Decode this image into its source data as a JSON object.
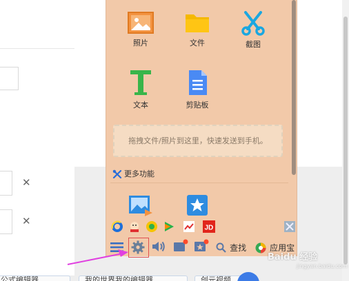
{
  "panel": {
    "tools": [
      {
        "icon": "image-icon",
        "label": "照片"
      },
      {
        "icon": "folder-icon",
        "label": "文件"
      },
      {
        "icon": "scissors-icon",
        "label": "截图"
      },
      {
        "icon": "text-icon",
        "label": "文本"
      },
      {
        "icon": "clipboard-icon",
        "label": "剪贴板"
      }
    ],
    "drop_zone_text": "拖拽文件/照片到这里，快速发送到手机。",
    "more_label": "更多功能",
    "bottom_bar": {
      "find_label": "查找",
      "apps_label": "应用宝"
    }
  },
  "background": {
    "tabs": [
      "公式编辑器",
      "我的世界我的编辑器",
      "创元视频"
    ]
  },
  "watermark": {
    "text": "Baidu 经验",
    "sub": "jingyan.baidu.com"
  },
  "colors": {
    "panel_bg": "#f2c9a9",
    "highlight_box": "#e05050",
    "arrow": "#e040e0",
    "accent_blue": "#3c7be6"
  }
}
